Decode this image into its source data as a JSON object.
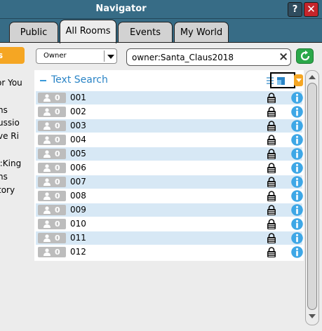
{
  "window": {
    "title": "Navigator",
    "help_label": "?",
    "close_label": "✕"
  },
  "tabs": [
    {
      "label": "Public",
      "active": false
    },
    {
      "label": "All Rooms",
      "active": true
    },
    {
      "label": "Events",
      "active": false
    },
    {
      "label": "My World",
      "active": false
    }
  ],
  "left_panel": {
    "header": "s",
    "items": [
      "or You",
      "ns",
      "ussio",
      "ve Ri",
      "r:King",
      "ns",
      "tory"
    ]
  },
  "search": {
    "filter_selected": "Owner",
    "query": "owner:Santa_Claus2018"
  },
  "results": {
    "title": "Text Search",
    "rooms": [
      {
        "name": "001",
        "users": "0"
      },
      {
        "name": "002",
        "users": "0"
      },
      {
        "name": "003",
        "users": "0"
      },
      {
        "name": "004",
        "users": "0"
      },
      {
        "name": "005",
        "users": "0"
      },
      {
        "name": "006",
        "users": "0"
      },
      {
        "name": "007",
        "users": "0"
      },
      {
        "name": "008",
        "users": "0"
      },
      {
        "name": "009",
        "users": "0"
      },
      {
        "name": "010",
        "users": "0"
      },
      {
        "name": "011",
        "users": "0"
      },
      {
        "name": "012",
        "users": "0"
      }
    ]
  },
  "colors": {
    "titlebar": "#376c86",
    "accent_orange": "#f5a623",
    "row_alt": "#d7e8f5",
    "refresh_green": "#2ba84a",
    "info_blue": "#3ea7e6"
  },
  "icons": {
    "help": "question-icon",
    "close": "close-icon",
    "refresh": "refresh-icon",
    "clear": "clear-icon",
    "collapse": "minus-icon",
    "list_view": "list-view-icon",
    "tile_view": "tile-view-icon",
    "user": "user-icon",
    "lock": "lock-icon",
    "info": "info-icon"
  }
}
